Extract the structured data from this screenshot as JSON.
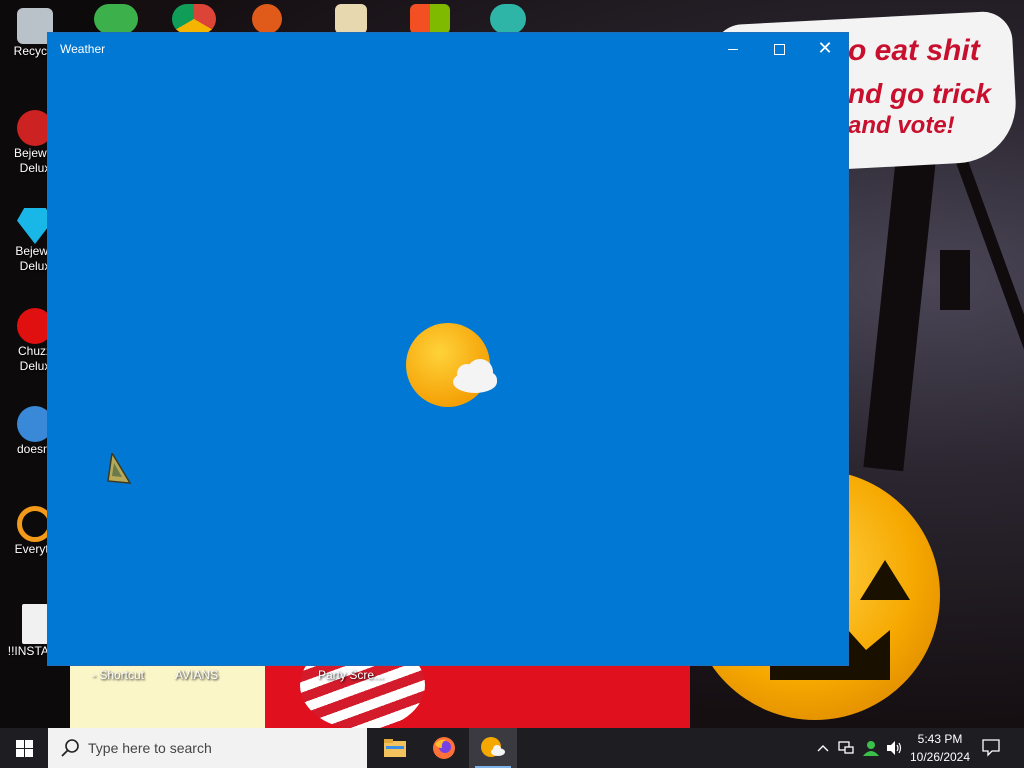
{
  "window": {
    "title": "Weather",
    "controls": [
      "minimize",
      "maximize",
      "close"
    ],
    "splash_icon": "weather-sun-cloud-icon"
  },
  "wallpaper": {
    "speech_bubble": [
      "o eat shit",
      "nd go trick",
      "and vote!"
    ]
  },
  "desktop_icons": [
    {
      "label": "Recycle",
      "icon": "recycle-bin-icon"
    },
    {
      "label": "Bejewel Delux",
      "icon": "bejeweled-red-icon"
    },
    {
      "label": "Bejewe Delux",
      "icon": "bejeweled-diamond-icon"
    },
    {
      "label": "Chuzz Delux",
      "icon": "chuzzle-icon"
    },
    {
      "label": "doesnt",
      "icon": "thunderbird-icon"
    },
    {
      "label": "Everyth",
      "icon": "everything-search-icon"
    },
    {
      "label": "!!INSTALL",
      "icon": "text-file-icon"
    }
  ],
  "bottom_labels": [
    "- Shortcut",
    "AVIANS",
    "Party Scre..."
  ],
  "taskbar": {
    "search_placeholder": "Type here to search",
    "apps": [
      "file-explorer-icon",
      "firefox-icon",
      "weather-icon"
    ],
    "active_app": "weather-icon",
    "time": "5:43 PM",
    "date": "10/26/2024"
  },
  "colors": {
    "window_bg": "#0078d4",
    "taskbar_bg": "#1d1d22",
    "bubble_text": "#c8102e",
    "sun": "#f6a800"
  }
}
